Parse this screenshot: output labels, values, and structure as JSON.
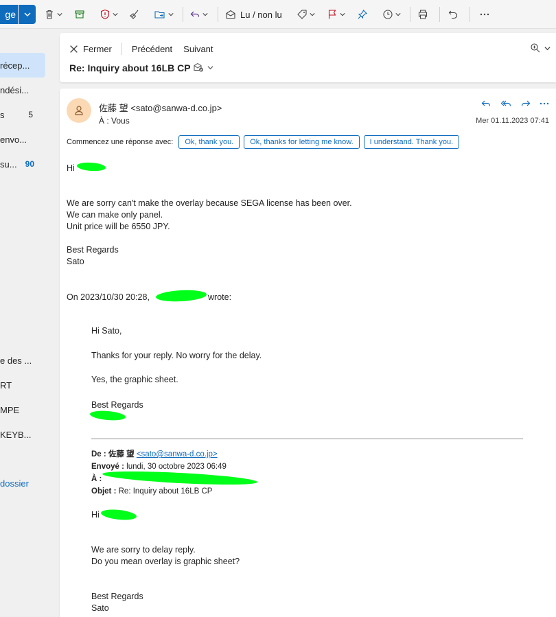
{
  "toolbar": {
    "new_label": "ge",
    "read_unread": "Lu / non lu"
  },
  "sidebar": {
    "items": [
      {
        "label": "récep...",
        "count": ""
      },
      {
        "label": "ndési...",
        "count": ""
      },
      {
        "label": "s",
        "count": "5"
      },
      {
        "label": " envo...",
        "count": ""
      },
      {
        "label": " su...",
        "count": "90"
      },
      {
        "label": "e des ...",
        "count": ""
      },
      {
        "label": "RT",
        "count": ""
      },
      {
        "label": "MPE",
        "count": ""
      },
      {
        "label": "KEYB...",
        "count": ""
      }
    ],
    "new_folder": "dossier"
  },
  "header": {
    "close": "Fermer",
    "previous": "Précédent",
    "next": "Suivant",
    "subject": "Re: Inquiry about 16LB CP"
  },
  "message": {
    "sender": "佐藤 望 <sato@sanwa-d.co.jp>",
    "to": "À :  Vous",
    "date": "Mer 01.11.2023 07:41",
    "quick_reply_label": "Commencez une réponse avec:",
    "quick_replies": [
      "Ok, thank you.",
      "Ok, thanks for letting me know.",
      "I understand. Thank you."
    ],
    "greeting": "Hi",
    "line1": "We are sorry can't make the overlay because SEGA license has been over.",
    "line2": "We can make only panel.",
    "line3": "Unit price will be 6550 JPY.",
    "regards": "Best Regards",
    "signature": "Sato",
    "on_prefix": "On 2023/10/30 20:28,",
    "on_suffix": "wrote:"
  },
  "quoted": {
    "greeting": "Hi Sato,",
    "line1": "Thanks for your reply. No worry for the delay.",
    "line2": "Yes, the graphic sheet.",
    "regards": "Best Regards"
  },
  "forwarded": {
    "from_label": "De :",
    "from_name": "佐藤 望",
    "from_email": "<sato@sanwa-d.co.jp>",
    "sent_label": "Envoyé :",
    "sent_value": "lundi, 30 octobre 2023 06:49",
    "to_label": "À :",
    "subject_label": "Objet :",
    "subject_value": "Re: Inquiry about 16LB CP",
    "greeting": "Hi",
    "line1": "We are sorry to delay reply.",
    "line2": "Do you mean overlay is graphic sheet?",
    "regards": "Best Regards",
    "signature": "Sato"
  },
  "colors": {
    "accent": "#0f6cbd",
    "redact": "#00ff19",
    "avatar_bg": "#fbd9b5"
  }
}
